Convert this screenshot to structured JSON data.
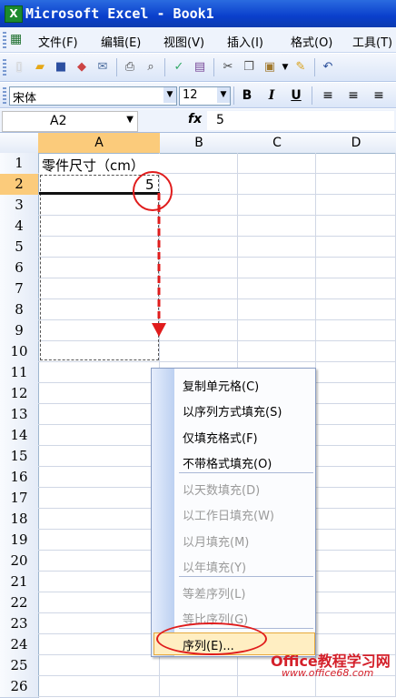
{
  "window": {
    "title": "Microsoft Excel - Book1",
    "app_icon": "X"
  },
  "menu": [
    "文件(F)",
    "编辑(E)",
    "视图(V)",
    "插入(I)",
    "格式(O)",
    "工具(T)"
  ],
  "format_toolbar": {
    "font": "宋体",
    "size": "12",
    "bold": "B",
    "italic": "I",
    "underline": "U"
  },
  "formula_bar": {
    "name_box": "A2",
    "fx": "fx",
    "content": "5"
  },
  "columns": [
    "A",
    "B",
    "C",
    "D"
  ],
  "rows": [
    "1",
    "2",
    "3",
    "4",
    "5",
    "6",
    "7",
    "8",
    "9",
    "10",
    "11",
    "12",
    "13",
    "14",
    "15",
    "16",
    "17",
    "18",
    "19",
    "20",
    "21",
    "22",
    "23",
    "24",
    "25",
    "26"
  ],
  "cells": {
    "A1": "零件尺寸（cm）",
    "A2": "5"
  },
  "context_menu": {
    "items": [
      {
        "label": "复制单元格(C)",
        "enabled": true
      },
      {
        "label": "以序列方式填充(S)",
        "enabled": true
      },
      {
        "label": "仅填充格式(F)",
        "enabled": true
      },
      {
        "label": "不带格式填充(O)",
        "enabled": true
      },
      {
        "label": "以天数填充(D)",
        "enabled": false
      },
      {
        "label": "以工作日填充(W)",
        "enabled": false
      },
      {
        "label": "以月填充(M)",
        "enabled": false
      },
      {
        "label": "以年填充(Y)",
        "enabled": false
      },
      {
        "label": "等差序列(L)",
        "enabled": false
      },
      {
        "label": "等比序列(G)",
        "enabled": false
      },
      {
        "label": "序列(E)...",
        "enabled": true
      }
    ]
  },
  "watermark": {
    "line1": "Office教程学习网",
    "line2": "www.office68.com"
  },
  "colors": {
    "selection": "#fbcb7b",
    "annotation": "#e01c1c",
    "highlight": "#ffeec2"
  }
}
